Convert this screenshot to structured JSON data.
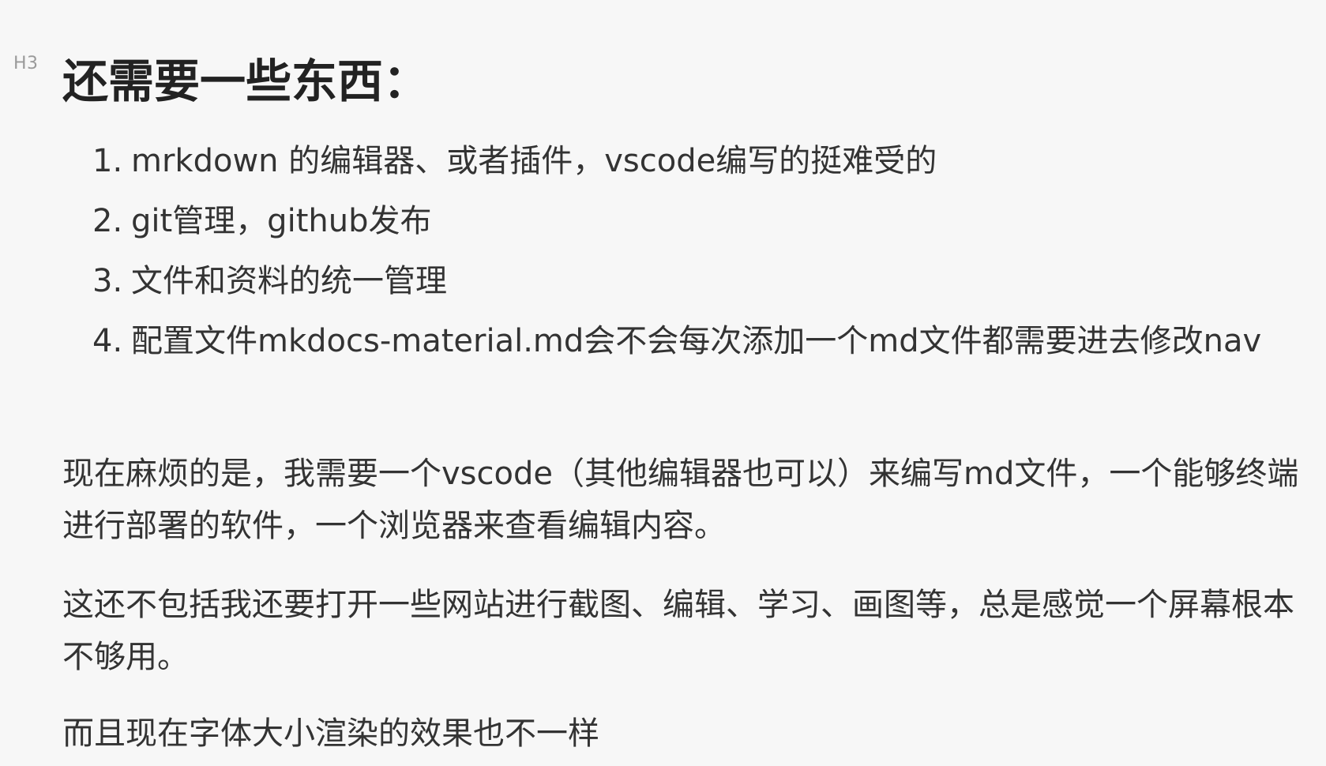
{
  "document": {
    "heading": {
      "level_marker": "H3",
      "text": "还需要一些东西："
    },
    "list_items": [
      {
        "number": "1.",
        "text": "mrkdown 的编辑器、或者插件，vscode编写的挺难受的"
      },
      {
        "number": "2.",
        "text": "git管理，github发布"
      },
      {
        "number": "3.",
        "text": "文件和资料的统一管理"
      },
      {
        "number": "4.",
        "text": "配置文件mkdocs-material.md会不会每次添加一个md文件都需要进去修改nav"
      }
    ],
    "paragraphs": [
      "现在麻烦的是，我需要一个vscode（其他编辑器也可以）来编写md文件，一个能够终端进行部署的软件，一个浏览器来查看编辑内容。",
      "这还不包括我还要打开一些网站进行截图、编辑、学习、画图等，总是感觉一个屏幕根本不够用。",
      "而且现在字体大小渲染的效果也不一样"
    ]
  }
}
